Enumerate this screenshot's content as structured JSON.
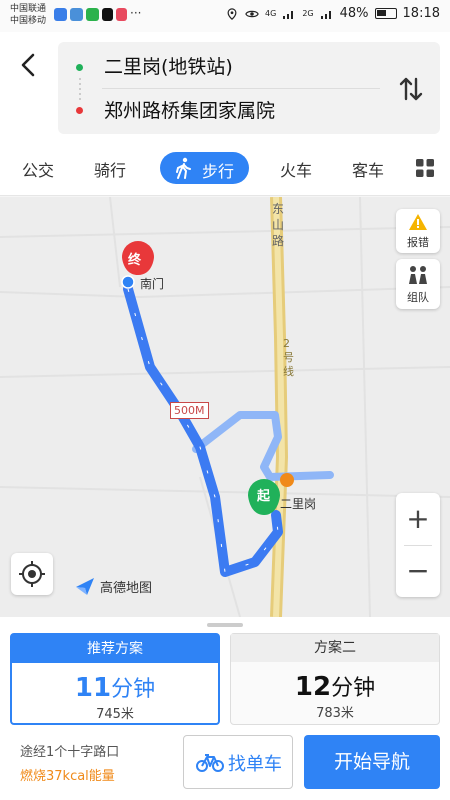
{
  "status_bar": {
    "carrier1": "中国联通",
    "carrier2": "中国移动",
    "network": "4G",
    "signal2": "2G",
    "battery": "48%",
    "time": "18:18",
    "overflow": "···"
  },
  "route": {
    "start": "二里岗(地铁站)",
    "end": "郑州路桥集团家属院"
  },
  "tabs": {
    "bus": "公交",
    "cycling": "骑行",
    "walking": "步行",
    "train": "火车",
    "coach": "客车"
  },
  "map": {
    "report_label": "报错",
    "team_label": "组队",
    "scale": "500M",
    "end_marker": "终",
    "start_marker": "起",
    "end_place": "南门",
    "start_place": "二里岗",
    "road_name": "东山路",
    "metro_line": "2号线",
    "logo_text": "高德地图",
    "zoom_in": "+",
    "zoom_out": "−",
    "colors": {
      "route": "#3c7bf2",
      "route_light": "#8fb6f7",
      "metro": "#e6cc7a"
    }
  },
  "plans": [
    {
      "title": "推荐方案",
      "minutes": "11",
      "unit": "分钟",
      "distance": "745米"
    },
    {
      "title": "方案二",
      "minutes": "12",
      "unit": "分钟",
      "distance": "783米"
    }
  ],
  "summary": {
    "via": "途经1个十字路口",
    "calories": "燃烧37kcal能量"
  },
  "actions": {
    "bike": "找单车",
    "navigate": "开始导航"
  }
}
